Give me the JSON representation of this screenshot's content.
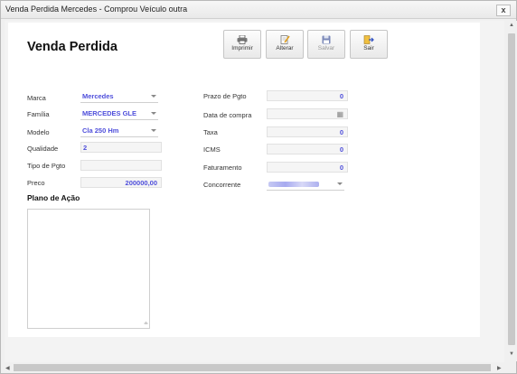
{
  "window": {
    "title": "Venda Perdida Mercedes - Comprou Veículo outra",
    "close": "x"
  },
  "page": {
    "heading": "Venda Perdida"
  },
  "toolbar": {
    "print_label": "Imprimir",
    "edit_label": "Alterar",
    "save_label": "Salvar",
    "exit_label": "Sair"
  },
  "form": {
    "marca": {
      "label": "Marca",
      "value": "Mercedes"
    },
    "familia": {
      "label": "Família",
      "value": "MERCEDES GLE"
    },
    "modelo": {
      "label": "Modelo",
      "value": "Cla 250 Hm"
    },
    "qualidade": {
      "label": "Qualidade",
      "value": "2"
    },
    "tipo_pgto": {
      "label": "Tipo de Pgto",
      "value": ""
    },
    "preco": {
      "label": "Preco",
      "value": "200000,00"
    },
    "prazo_pgto": {
      "label": "Prazo de Pgto",
      "value": "0"
    },
    "data_compra": {
      "label": "Data de compra",
      "value": ""
    },
    "taxa": {
      "label": "Taxa",
      "value": "0"
    },
    "icms": {
      "label": "ICMS",
      "value": "0"
    },
    "faturamento": {
      "label": "Faturamento",
      "value": "0"
    },
    "concorrente": {
      "label": "Concorrente",
      "value": ""
    }
  },
  "plano": {
    "title": "Plano de Ação",
    "text": ""
  },
  "colors": {
    "value_blue": "#4f4fdb",
    "panel_bg": "#ffffff",
    "window_bg": "#f0f0f0"
  },
  "icons": [
    "printer-icon",
    "edit-icon",
    "save-icon",
    "exit-icon",
    "calendar-icon",
    "close-icon"
  ]
}
